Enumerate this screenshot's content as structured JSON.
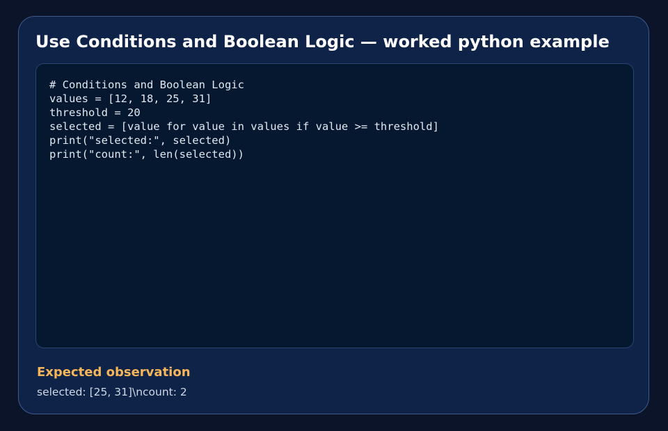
{
  "header": {
    "title": "Use Conditions and Boolean Logic — worked python example"
  },
  "code_block": {
    "lines": [
      "# Conditions and Boolean Logic",
      "values = [12, 18, 25, 31]",
      "threshold = 20",
      "selected = [value for value in values if value >= threshold]",
      "print(\"selected:\", selected)",
      "print(\"count:\", len(selected))"
    ]
  },
  "observation": {
    "heading": "Expected observation",
    "text": "selected: [25, 31]\\ncount: 2"
  },
  "colors": {
    "page_background": "#0b1428",
    "card_background": "#0e2347",
    "code_background": "#051830",
    "accent_heading": "#f5b55a",
    "title_text": "#ffffff"
  }
}
